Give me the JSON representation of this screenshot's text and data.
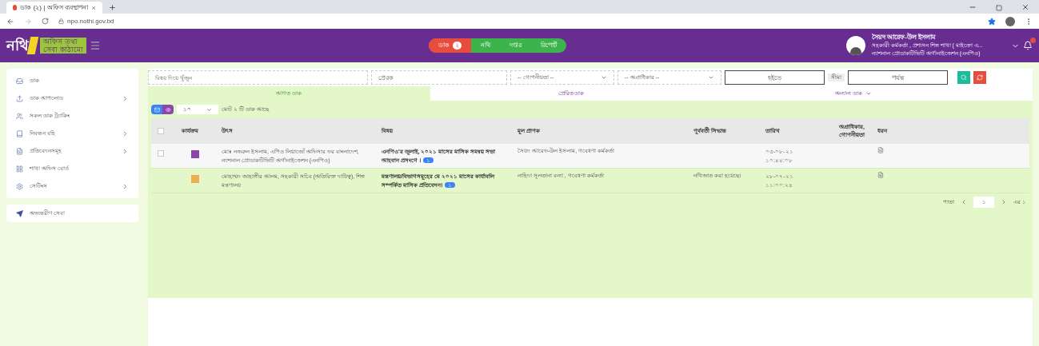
{
  "browser": {
    "tab_title": "ডাক (২) | অফিস ব্যবস্থাপনা",
    "url": "npo.nothi.gov.bd"
  },
  "header": {
    "logo": "নথি",
    "logo_sub": [
      "অফিস তথ্য",
      "সেবা কাঠামো"
    ],
    "nav": [
      {
        "label": "ডাক",
        "badge": "২",
        "selected": true
      },
      {
        "label": "নথি",
        "selected": false
      },
      {
        "label": "দপ্তর",
        "selected": false
      },
      {
        "label": "রিপোর্ট",
        "selected": false
      }
    ],
    "user": {
      "name": "সৈয়দ আরেফ-উল ইসলাম",
      "designation": "সহকারী কর্মকর্তা , প্রশাসন শিল্প শাখা ( মাইক্রো এ...",
      "office": "ন্যাশনাল প্রোডাকটিভিটি অর্গানাইজেশন (এনপিও)"
    }
  },
  "sidebar": {
    "items": [
      {
        "label": "ডাক",
        "expandable": false
      },
      {
        "label": "ডাক আপলোড",
        "expandable": true
      },
      {
        "label": "সকল ডাক ট্র্যাকিং",
        "expandable": false
      },
      {
        "label": "নিবন্ধন বহি",
        "expandable": true
      },
      {
        "label": "প্রতিবেদনসমূহ",
        "expandable": true
      },
      {
        "label": "শাখা অফিস বোর্ড",
        "expandable": false
      },
      {
        "label": "সেটিংস",
        "expandable": true
      }
    ],
    "extra": "অভ্যন্তরীণ সেবা"
  },
  "filters": {
    "subject": {
      "placeholder": "বিষয় দিয়ে খুঁজুন"
    },
    "sender": {
      "placeholder": "প্রেরক"
    },
    "secrecy": "-- গোপনীয়তা --",
    "priority": "-- অগ্রাধিকার --",
    "from": {
      "placeholder": "হইতে"
    },
    "between": "সীমা",
    "to": {
      "placeholder": "পর্যন্ত"
    }
  },
  "tabs": [
    {
      "label": "আগত ডাক",
      "selected": true
    },
    {
      "label": "প্রেরিত ডাক",
      "selected": false
    },
    {
      "label": "অন্যান্য ডাক",
      "selected": false
    }
  ],
  "page_size": "১০",
  "total": "মোট ২ টি ডাক আছে",
  "table": {
    "columns": [
      "কার্যক্রম",
      "উৎস",
      "বিষয়",
      "মূল প্রাপক",
      "পূর্ববর্তী সিদ্ধান্ত",
      "তারিখ",
      "অগ্রাধিকার, গোপনীয়তা",
      "ধরন"
    ],
    "select_all": {
      "checked": false
    },
    "rows": [
      {
        "kind": "open",
        "checked": false,
        "color": "#8e44ad",
        "source": "মোঃ নজরুল ইসলাম, এপিও লিয়াজোঁ অফিসার ফর বাংলাদেশ, ন্যাশনাল প্রোডাকটিভিটি অর্গানাইজেশন (এনপিও)",
        "subject": "এনপিও'র জুলাই, ২০২১ মাসের মাসিক সমন্বয় সভা আহবান প্রসংগে ।",
        "count": "১",
        "recipient": "সৈয়দ আরেফ-উল ইসলাম, গবেষণা কর্মকর্তা",
        "date": "০৩-০৮-২১",
        "time": "১০:৪৪:০৮"
      },
      {
        "kind": "filed",
        "color": "#f0ad4e",
        "source": "মোহাম্মদ জাহাঙ্গীর আলম, সহকারী সচিব (অতিরিক্ত দায়িত্ব), শিল্প মন্ত্রণালয়",
        "subject": "মন্ত্রণালয়/বিভাগসমূহের মে ২০২১ মাসের কার্যাবলি সম্পর্কিত মাসিক প্রতিবেদন।",
        "count": "১",
        "recipient": "নাহিদা সুলতানা বন্যা , গবেষণা কর্মকর্তা",
        "decision": "নথিজাত করা হয়েছে।",
        "date": "২৮-০৭-২১",
        "time": "১১:০০:২৪"
      }
    ]
  },
  "pagination": {
    "label": "পাতা",
    "page": "১",
    "of": "এর ১"
  }
}
